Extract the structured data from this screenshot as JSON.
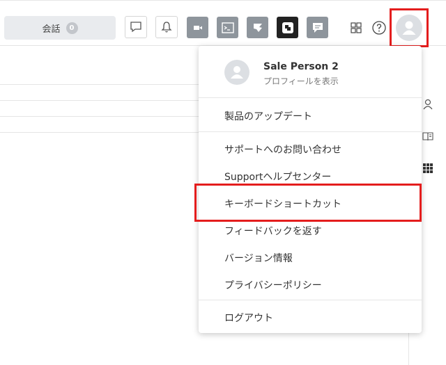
{
  "toolbar": {
    "conversation_label": "会話",
    "conversation_count": "0",
    "icons": [
      "chat-bubble-icon",
      "bell-icon",
      "video-camera-icon",
      "terminal-icon",
      "flag-icon",
      "app-logo-icon",
      "message-icon",
      "grid-icon",
      "help-icon",
      "user-avatar-icon"
    ]
  },
  "colors": {
    "accent_highlight": "#e41d1d",
    "tool_gray": "#8e959c",
    "tool_dark": "#222222",
    "avatar_bg": "#dcdfe3"
  },
  "user_menu": {
    "name": "Sale Person 2",
    "profile_link": "プロフィールを表示",
    "items": [
      "製品のアップデート",
      "サポートへのお問い合わせ",
      "Supportヘルプセンター",
      "キーボードショートカット",
      "フィードバックを返す",
      "バージョン情報",
      "プライバシーポリシー",
      "ログアウト"
    ]
  },
  "side_icons": [
    "person-icon",
    "book-icon",
    "apps-grid-icon"
  ]
}
